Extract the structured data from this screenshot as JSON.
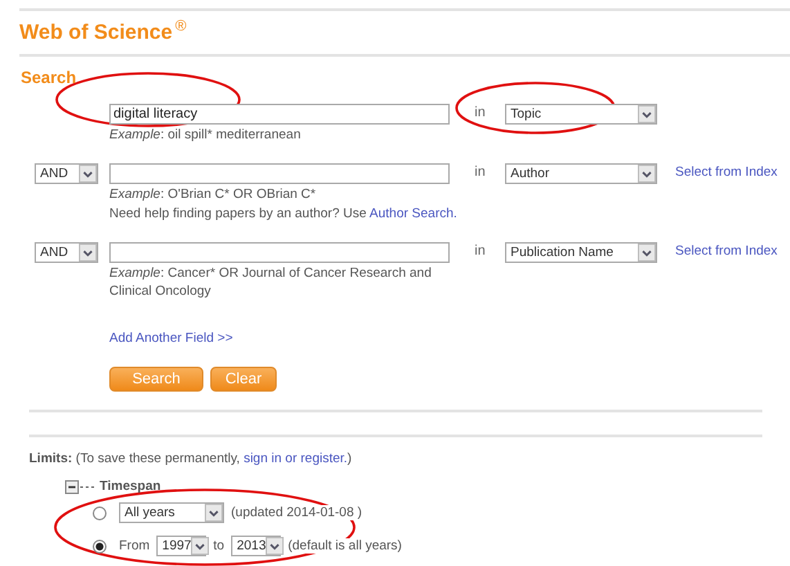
{
  "header": {
    "title": "Web of Science",
    "mark": "®"
  },
  "search": {
    "heading": "Search",
    "rows": [
      {
        "value": "digital literacy",
        "in_label": "in",
        "field": "Topic",
        "example_label": "Example",
        "example": ": oil spill* mediterranean"
      },
      {
        "operator": "AND",
        "in_label": "in",
        "field": "Author",
        "index_link": "Select from Index",
        "example_label": "Example",
        "example": ": O'Brian C* OR OBrian C*",
        "help": "Need help finding papers by an author? Use ",
        "help_link": "Author Search."
      },
      {
        "operator": "AND",
        "in_label": "in",
        "field": "Publication Name",
        "index_link": "Select from Index",
        "example_label": "Example",
        "example": ": Cancer* OR Journal of Cancer Research and Clinical Oncology"
      }
    ],
    "add_field_link": "Add Another Field >>",
    "buttons": [
      "Search",
      "Clear"
    ]
  },
  "limits": {
    "label": "Limits:",
    "note": "(To save these permanently, ",
    "link": "sign in or register.",
    "note_end": ")",
    "timespan": {
      "label": "Timespan",
      "expanded": true,
      "options": [
        {
          "kind": "preset",
          "selected": false,
          "select": "All years",
          "note": "(updated 2014-01-08 )"
        },
        {
          "kind": "range",
          "selected": true,
          "from_label": "From",
          "from": "1997",
          "to_label": "to",
          "to": "2013",
          "note": "(default is all years)"
        }
      ]
    }
  }
}
